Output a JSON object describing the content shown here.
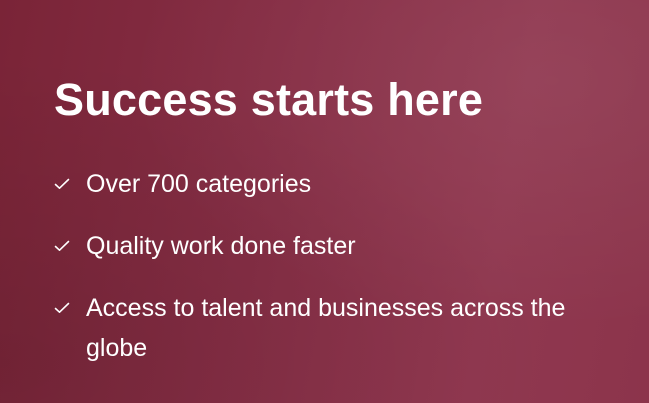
{
  "colors": {
    "background_start": "#7a2437",
    "background_end": "#903850",
    "text": "#ffffff"
  },
  "headline": "Success starts here",
  "features": [
    {
      "icon": "check-icon",
      "label": "Over 700 categories"
    },
    {
      "icon": "check-icon",
      "label": "Quality work done faster"
    },
    {
      "icon": "check-icon",
      "label": "Access to talent and businesses across the globe"
    }
  ]
}
